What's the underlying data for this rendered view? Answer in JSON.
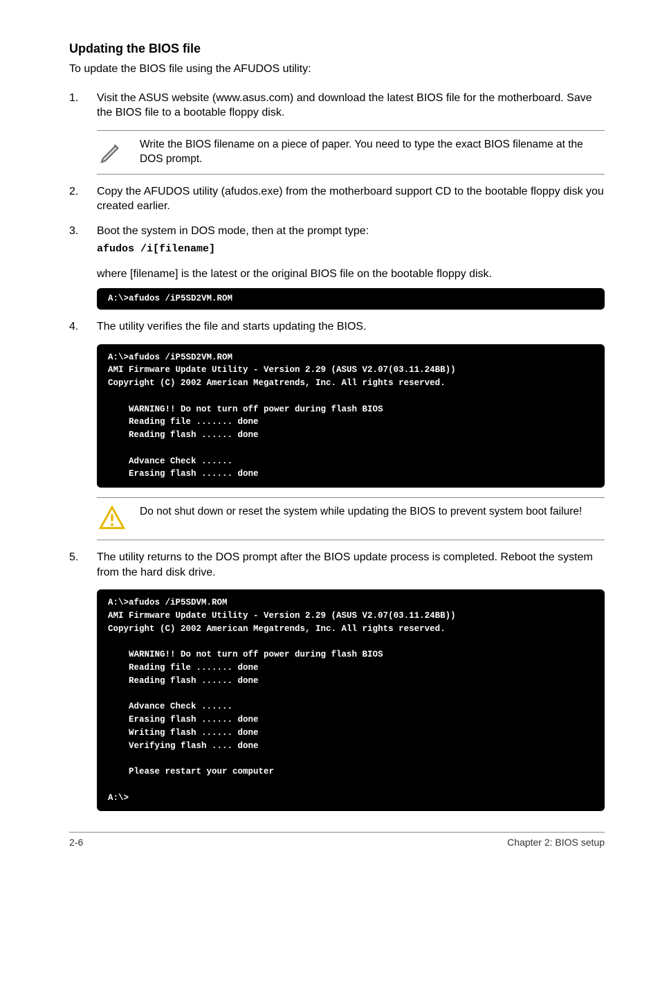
{
  "heading": "Updating the BIOS file",
  "intro": "To update the BIOS file using the AFUDOS utility:",
  "steps": {
    "s1_num": "1.",
    "s1": "Visit the ASUS website (www.asus.com) and download the latest BIOS file for the motherboard. Save the BIOS file to a bootable floppy disk.",
    "note1": "Write the BIOS filename on a piece of paper. You need to type the exact BIOS filename at the DOS prompt.",
    "s2_num": "2.",
    "s2": "Copy the AFUDOS utility (afudos.exe) from the motherboard support CD to the bootable floppy disk you created earlier.",
    "s3_num": "3.",
    "s3": "Boot the system in DOS mode, then at the prompt type:",
    "s3_cmd": "afudos /i[filename]",
    "s3_after": "where [filename] is the latest or the original BIOS file on the bootable floppy disk.",
    "term1": "A:\\>afudos /iP5SD2VM.ROM",
    "s4_num": "4.",
    "s4": "The utility verifies the file and starts updating the BIOS.",
    "term2": "A:\\>afudos /iP5SD2VM.ROM\nAMI Firmware Update Utility - Version 2.29 (ASUS V2.07(03.11.24BB))\nCopyright (C) 2002 American Megatrends, Inc. All rights reserved.\n\n    WARNING!! Do not turn off power during flash BIOS\n    Reading file ....... done\n    Reading flash ...... done\n\n    Advance Check ......\n    Erasing flash ...... done",
    "warn1": "Do not shut down or reset the system while updating the BIOS to prevent system boot failure!",
    "s5_num": "5.",
    "s5": "The utility returns to the DOS prompt after the BIOS update process is completed. Reboot the system from the hard disk drive.",
    "term3": "A:\\>afudos /iP5SDVM.ROM\nAMI Firmware Update Utility - Version 2.29 (ASUS V2.07(03.11.24BB))\nCopyright (C) 2002 American Megatrends, Inc. All rights reserved.\n\n    WARNING!! Do not turn off power during flash BIOS\n    Reading file ....... done\n    Reading flash ...... done\n\n    Advance Check ......\n    Erasing flash ...... done\n    Writing flash ...... done\n    Verifying flash .... done\n\n    Please restart your computer\n\nA:\\>"
  },
  "footer": {
    "left": "2-6",
    "right": "Chapter 2: BIOS setup"
  }
}
